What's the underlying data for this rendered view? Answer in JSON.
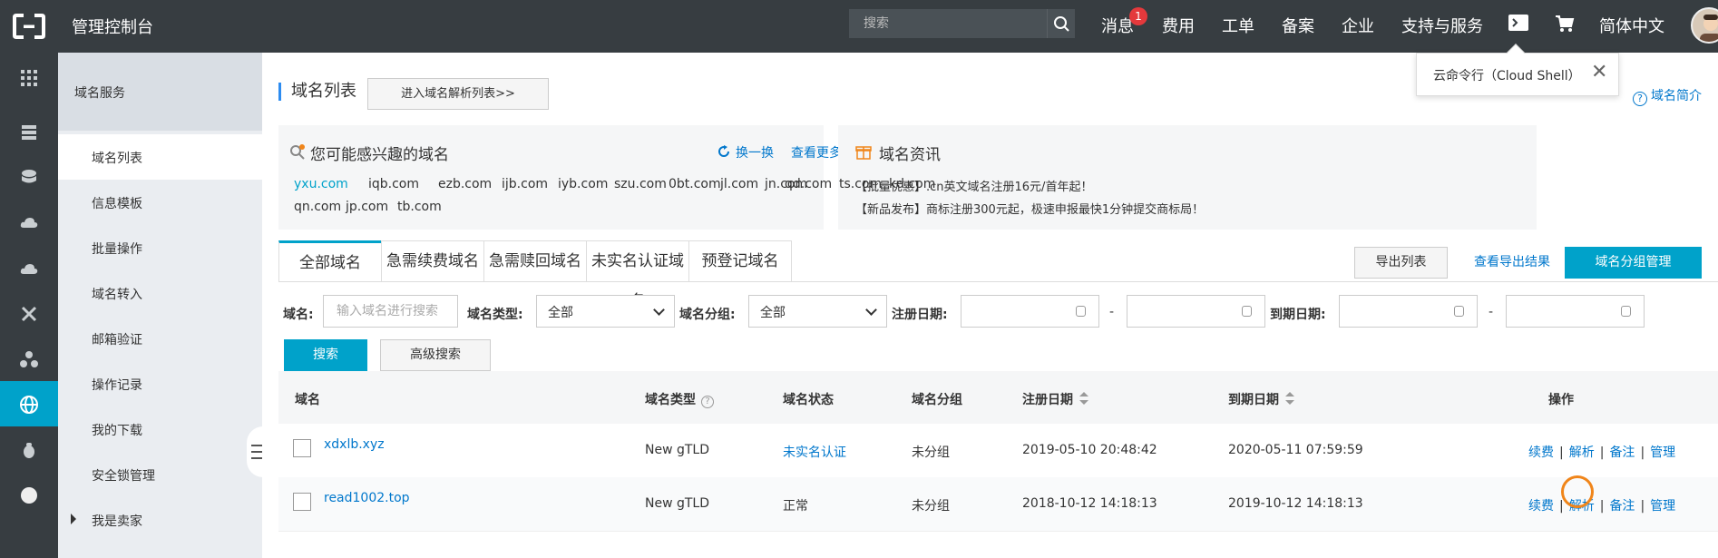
{
  "topbar": {
    "title": "管理控制台",
    "search_placeholder": "搜索",
    "links": [
      "消息",
      "费用",
      "工单",
      "备案",
      "企业",
      "支持与服务"
    ],
    "message_count": "1",
    "language": "简体中文",
    "icons": [
      "aliyun-logo-icon",
      "search-icon",
      "terminal-icon",
      "cart-icon",
      "avatar"
    ]
  },
  "tooltip": {
    "text": "云命令行（Cloud Shell）",
    "close": "✕"
  },
  "subnav": {
    "header": "域名服务",
    "items": [
      "域名列表",
      "信息模板",
      "批量操作",
      "域名转入",
      "邮箱验证",
      "操作记录",
      "我的下载",
      "安全锁管理",
      "我是卖家"
    ]
  },
  "page": {
    "title": "域名列表",
    "enter_dns": "进入域名解析列表>>",
    "intro": "域名简介"
  },
  "suggest": {
    "title": "您可能感兴趣的域名",
    "refresh": "换一换",
    "more": "查看更多",
    "domains": [
      "yxu.com",
      "iqb.com",
      "ezb.com",
      "ijb.com",
      "iyb.com",
      "szu.com",
      "0bt.com",
      "jl.com",
      "jn.com",
      "qd.com",
      "ts.com",
      "kd.com",
      "qn.com",
      "jp.com",
      "tb.com"
    ]
  },
  "news": {
    "title": "域名资讯",
    "lines": [
      "【批量优惠】.cn英文域名注册16元/首年起！",
      "【新品发布】商标注册300元起，极速申报最快1分钟提交商标局！"
    ]
  },
  "tabs": [
    "全部域名",
    "急需续费域名",
    "急需赎回域名",
    "未实名认证域名",
    "预登记域名"
  ],
  "actions": {
    "export": "导出列表",
    "view_export": "查看导出结果",
    "group_manage": "域名分组管理"
  },
  "filters": {
    "domain_label": "域名:",
    "domain_placeholder": "输入域名进行搜索",
    "type_label": "域名类型:",
    "type_value": "全部",
    "group_label": "域名分组:",
    "group_value": "全部",
    "reg_label": "注册日期:",
    "exp_label": "到期日期:",
    "dash": "-",
    "search": "搜索",
    "advanced": "高级搜索"
  },
  "table": {
    "headers": [
      "域名",
      "域名类型",
      "域名状态",
      "域名分组",
      "注册日期",
      "到期日期",
      "操作"
    ],
    "ops": [
      "续费",
      "解析",
      "备注",
      "管理"
    ],
    "rows": [
      {
        "domain": "xdxlb.xyz",
        "type": "New gTLD",
        "status": "未实名认证",
        "group": "未分组",
        "reg": "2019-05-10 20:48:42",
        "exp": "2020-05-11 07:59:59"
      },
      {
        "domain": "read1002.top",
        "type": "New gTLD",
        "status": "正常",
        "group": "未分组",
        "reg": "2018-10-12 14:18:13",
        "exp": "2019-10-12 14:18:13"
      }
    ]
  },
  "colors": {
    "topbar": "#373d41",
    "accent": "#00a2ca",
    "link": "#0077cc",
    "highlight_circle": "#f0851a",
    "badge": "#e4393c"
  }
}
